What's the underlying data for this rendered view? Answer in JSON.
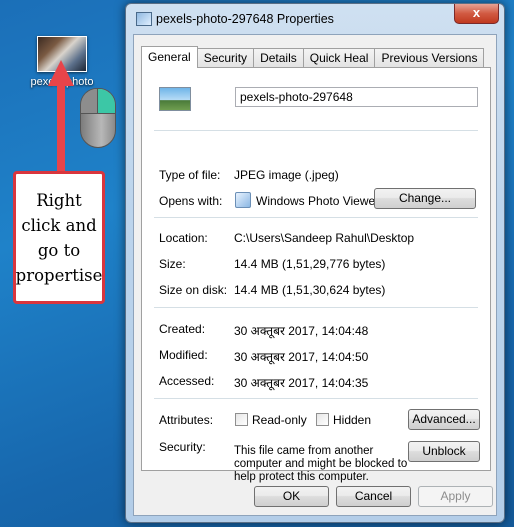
{
  "desktop": {
    "icon_label": "pexels-photo"
  },
  "annotation": {
    "text": "Right click and go to propertise"
  },
  "window": {
    "title": "pexels-photo-297648 Properties",
    "close_label": "x"
  },
  "tabs": [
    {
      "label": "General",
      "active": true
    },
    {
      "label": "Security"
    },
    {
      "label": "Details"
    },
    {
      "label": "Quick Heal"
    },
    {
      "label": "Previous Versions"
    }
  ],
  "general": {
    "file_name": "pexels-photo-297648",
    "type_label": "Type of file:",
    "type_value": "JPEG image (.jpeg)",
    "opens_label": "Opens with:",
    "opens_value": "Windows Photo Viewer",
    "change_button": "Change...",
    "location_label": "Location:",
    "location_value": "C:\\Users\\Sandeep Rahul\\Desktop",
    "size_label": "Size:",
    "size_value": "14.4 MB (1,51,29,776 bytes)",
    "size_on_disk_label": "Size on disk:",
    "size_on_disk_value": "14.4 MB (1,51,30,624 bytes)",
    "created_label": "Created:",
    "created_value": "30 अक्तूबर 2017, 14:04:48",
    "modified_label": "Modified:",
    "modified_value": "30 अक्तूबर 2017, 14:04:50",
    "accessed_label": "Accessed:",
    "accessed_value": "30 अक्तूबर 2017, 14:04:35",
    "attributes_label": "Attributes:",
    "readonly_label": "Read-only",
    "readonly_checked": false,
    "hidden_label": "Hidden",
    "hidden_checked": false,
    "advanced_button": "Advanced...",
    "security_label": "Security:",
    "security_text": "This file came from another computer and might be blocked to help protect this computer.",
    "unblock_button": "Unblock"
  },
  "footer": {
    "ok_button": "OK",
    "cancel_button": "Cancel",
    "apply_button": "Apply"
  },
  "colors": {
    "desktop_bg": "#1f82c9",
    "arrow": "#e8444a",
    "annotation_border": "#d9363e",
    "mouse_right_button": "#3cc7a6"
  }
}
